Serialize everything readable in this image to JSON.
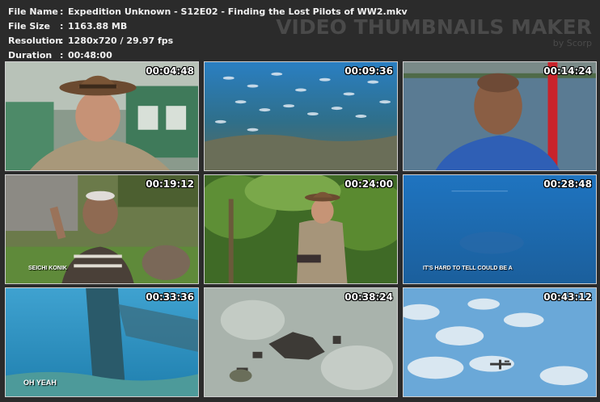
{
  "info": {
    "rows": [
      {
        "key": "File Name",
        "value": "Expedition Unknown - S12E02 - Finding the Lost Pilots of WW2.mkv"
      },
      {
        "key": "File Size",
        "value": "1163.88 MB"
      },
      {
        "key": "Resolution",
        "value": "1280x720 / 29.97 fps"
      },
      {
        "key": "Duration",
        "value": "00:48:00"
      }
    ],
    "colon": ":"
  },
  "brand": {
    "title": "VIDEO THUMBNAILS MAKER",
    "subtitle": "by Scorp"
  },
  "thumbnails": [
    {
      "time": "00:04:48",
      "scene": "man in brown fedora in front of green building"
    },
    {
      "time": "00:09:36",
      "scene": "school of fish above reef underwater"
    },
    {
      "time": "00:14:24",
      "scene": "man in blue shirt on boat by the sea"
    },
    {
      "time": "00:19:12",
      "scene": "elderly man gesturing by stone wall",
      "caption": "SEICHI KONIK"
    },
    {
      "time": "00:24:00",
      "scene": "man in fedora in jungle"
    },
    {
      "time": "00:28:48",
      "scene": "blue underwater view with title text",
      "caption": "IT'S HARD TO TELL COULD BE A"
    },
    {
      "time": "00:33:36",
      "scene": "underwater wreck structure",
      "caption": "OH YEAH"
    },
    {
      "time": "00:38:24",
      "scene": "debris on sandy seafloor"
    },
    {
      "time": "00:43:12",
      "scene": "aircraft among clouds"
    }
  ],
  "colors": {
    "background": "#2b2b2b",
    "text": "#f2f2f2",
    "brand": "#4a4a4a",
    "border": "#cfcfcf"
  }
}
